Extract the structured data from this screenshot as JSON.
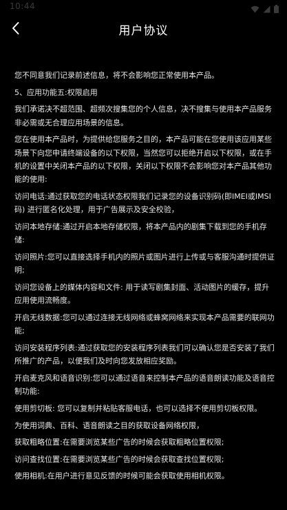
{
  "status_bar": {
    "time": "10:44",
    "icons": [
      "wifi-icon",
      "signal-icon",
      "battery-icon"
    ],
    "icon_color": "#3a3a3a"
  },
  "nav": {
    "title": "用户协议",
    "back_icon": "chevron-left-icon"
  },
  "colors": {
    "background": "#000000",
    "text": "#e6e6e6",
    "title": "#ffffff"
  },
  "paragraphs": [
    "您不同意我们记录前述信息，将不会影响您正常使用本产品。",
    "5、应用功能五:权限启用",
    "我们承诺决不超范围、超频次搜集您的个人信息，决不搜集与使用本产品服务非必需或无合理应用场景的信息。",
    "您在使用本产品时，为提供给您服务之目的，本产品可能在您使用该应用某些场景下向您申请终端设备的以下权限，当然您可以拒绝开启以下权限，或在手机的设置中关闭本产品的以下权限，关闭以下权限不会影响您对本产品其他功能的使用:",
    "访问电话:通过获取您的电话状态权限我们记录您的设备识别码(即IMEI或IMSI码) 进行匿名化处理，用于广告展示及安全校验，",
    "访问本地存储:通过开启本地存储权限，将本产品内的剧集下载到您的手机存储:",
    "访问照片:您可以直接选择手机内的照片或图片进行上传或与客服沟通时提供证明;",
    "访问您设备上的媒体内容和文件: 用于读写剧集封面、活动图片的缓存，提升应用使用流畅度。",
    "开启无线数据:您可以通过连接无线网络或蜂窝网络来实现本产品需要的联网功能;",
    "访问安装程序列表:通过获取您的安装程序列表我们可以确认您是否安装了我们所推广的产品，以便我们及时向您发放相应奖励。",
    "开启麦克风和语音识别:您可以通过语音来控制本产品的语音朗读功能及语音控制功能:",
    "使用剪切板: 您可以复制并粘贴客服电话，也可以选择不使用剪切板权限。",
    "为使用词典、百科、语音朗读之目的获取设备网络权限，",
    "获取粗略位置:在需要浏览某些广告的时候会获取粗略位置权限;",
    "访问查找位置:在需要浏览某些广告的时候会获取查找位置权限;",
    "使用相机:在用户进行意见反馈的时候可能会获取使用相机权限。"
  ]
}
